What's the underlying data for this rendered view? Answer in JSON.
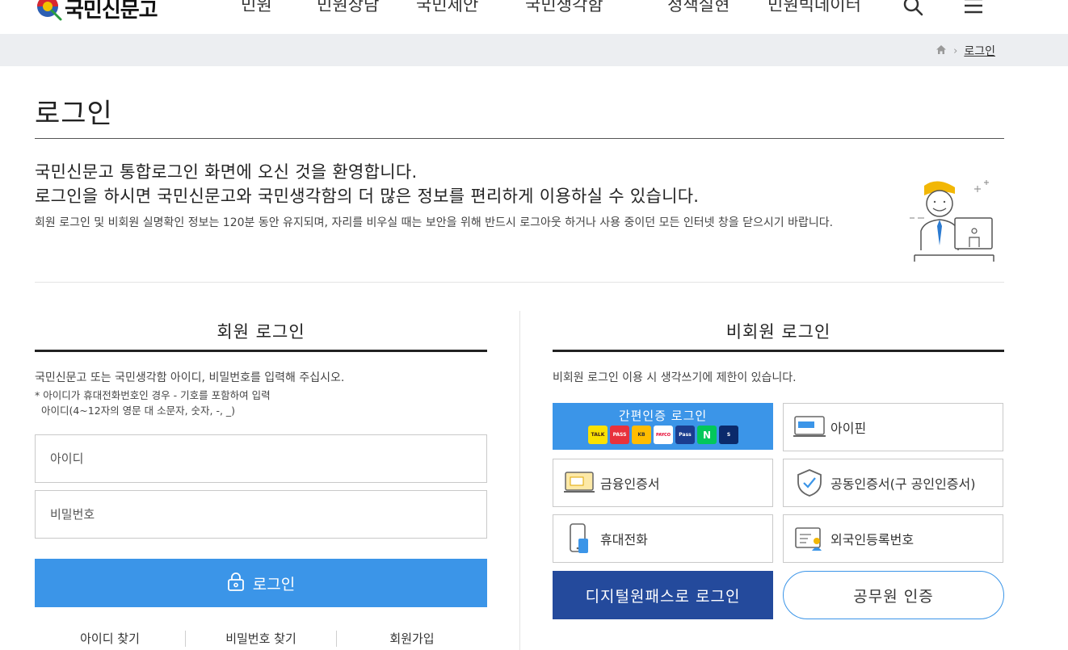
{
  "header": {
    "logo_text": "국민신문고",
    "nav": [
      "민원",
      "민원상담",
      "국민제안",
      "국민생각함",
      "정책실현",
      "민원빅데이터"
    ]
  },
  "breadcrumb": {
    "current": "로그인"
  },
  "page": {
    "title": "로그인",
    "welcome_line1": "국민신문고 통합로그인 화면에 오신 것을 환영합니다.",
    "welcome_line2": "로그인을 하시면 국민신문고와 국민생각함의 더 많은 정보를 편리하게 이용하실 수 있습니다.",
    "notice": "회원 로그인 및 비회원 실명확인 정보는 120분 동안 유지되며, 자리를 비우실 때는 보안을 위해 반드시 로그아웃 하거나 사용 중이던 모든 인터넷 창을 닫으시기 바랍니다."
  },
  "member": {
    "title": "회원 로그인",
    "desc": "국민신문고 또는 국민생각함 아이디, 비밀번호를 입력해 주십시오.",
    "hint1": "* 아이디가 휴대전화번호인 경우 - 기호를 포함하여 입력",
    "hint2": "  아이디(4~12자의 영문 대 소문자, 숫자, -, _)",
    "id_placeholder": "아이디",
    "pw_placeholder": "비밀번호",
    "login_label": "로그인",
    "links": [
      "아이디 찾기",
      "비밀번호 찾기",
      "회원가입"
    ]
  },
  "guest": {
    "title": "비회원 로그인",
    "desc": "비회원 로그인 이용 시 생각쓰기에 제한이 있습니다.",
    "simple_title": "간편인증 로그인",
    "simple_badges": [
      "TALK",
      "PASS",
      "KB",
      "PAYCO",
      "Pass",
      "N",
      "S"
    ],
    "ipin": "아이핀",
    "finance_cert": "금융인증서",
    "joint_cert": "공동인증서(구 공인인증서)",
    "mobile": "휴대전화",
    "foreigner": "외국인등록번호",
    "digital_onepass": "디지털원패스로 로그인",
    "official": "공무원 인증"
  },
  "colors": {
    "accent": "#3b95e8",
    "navy": "#244a9c"
  }
}
